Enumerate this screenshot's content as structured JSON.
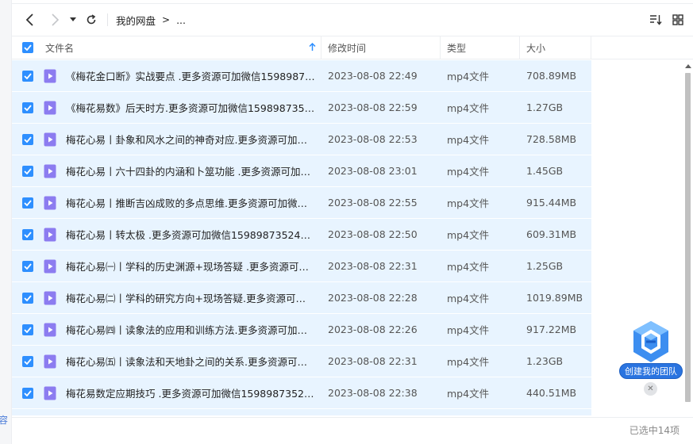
{
  "toolbar": {
    "breadcrumb_root": "我的网盘",
    "breadcrumb_arrow": ">",
    "breadcrumb_more": "..."
  },
  "table": {
    "headers": {
      "name": "文件名",
      "time": "修改时间",
      "type": "类型",
      "size": "大小"
    },
    "sort": {
      "column": "name",
      "direction": "ascending"
    },
    "rows": [
      {
        "name": "《梅花金口断》实战要点 .更多资源可加微信159898735...",
        "time": "2023-08-08 22:49",
        "type": "mp4文件",
        "size": "708.89MB",
        "checked": true
      },
      {
        "name": "《梅花易数》后天时方.更多资源可加微信159898735245...",
        "time": "2023-08-08 22:59",
        "type": "mp4文件",
        "size": "1.27GB",
        "checked": true
      },
      {
        "name": "梅花心易丨卦象和风水之间的神奇对应.更多资源可加微信...",
        "time": "2023-08-08 22:53",
        "type": "mp4文件",
        "size": "728.58MB",
        "checked": true
      },
      {
        "name": "梅花心易丨六十四卦的内涵和卜筮功能 .更多资源可加微...",
        "time": "2023-08-08 23:01",
        "type": "mp4文件",
        "size": "1.45GB",
        "checked": true
      },
      {
        "name": "梅花心易丨推断吉凶成败的多点思维.更多资源可加微信1...",
        "time": "2023-08-08 22:55",
        "type": "mp4文件",
        "size": "915.44MB",
        "checked": true
      },
      {
        "name": "梅花心易丨转太极 .更多资源可加微信159898735245666...",
        "time": "2023-08-08 22:50",
        "type": "mp4文件",
        "size": "609.31MB",
        "checked": true
      },
      {
        "name": "梅花心易㈠丨学科的历史渊源+现场答疑 .更多资源可加微...",
        "time": "2023-08-08 22:31",
        "type": "mp4文件",
        "size": "1.25GB",
        "checked": true
      },
      {
        "name": "梅花心易㈡丨学科的研究方向+现场答疑.更多资源可加微...",
        "time": "2023-08-08 22:28",
        "type": "mp4文件",
        "size": "1019.89MB",
        "checked": true
      },
      {
        "name": "梅花心易㈣丨读象法的应用和训练方法.更多资源可加微信...",
        "time": "2023-08-08 22:26",
        "type": "mp4文件",
        "size": "917.22MB",
        "checked": true
      },
      {
        "name": "梅花心易㈤丨读象法和天地卦之间的关系.更多资源可加微...",
        "time": "2023-08-08 22:31",
        "type": "mp4文件",
        "size": "1.23GB",
        "checked": true
      },
      {
        "name": "梅花易数定应期技巧 .更多资源可加微信1598987352421...",
        "time": "2023-08-08 22:38",
        "type": "mp4文件",
        "size": "440.51MB",
        "checked": true
      }
    ]
  },
  "widget": {
    "team_label": "创建我的团队"
  },
  "footer": {
    "selected_text": "已选中14项"
  },
  "gutter": {
    "partial_char": "容"
  },
  "colors": {
    "accent": "#2e8fff",
    "row_selected": "#e8f4ff",
    "file_icon": "#8c7cf0"
  },
  "icons": [
    "back-arrow-icon",
    "forward-arrow-icon",
    "dropdown-caret-icon",
    "refresh-icon",
    "sort-list-icon",
    "grid-view-icon",
    "checkbox-icon",
    "video-file-icon",
    "sort-ascending-icon",
    "team-logo-icon",
    "close-icon"
  ]
}
